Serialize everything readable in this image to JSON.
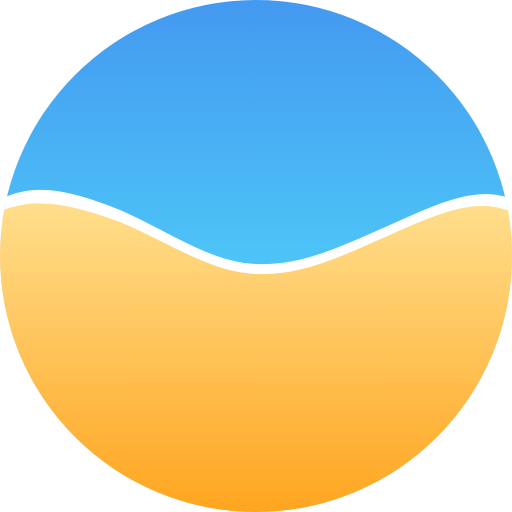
{
  "logo": {
    "icon": "sky-and-sand-circle-icon",
    "colors": {
      "sky_top": "#4499F0",
      "sky_bottom": "#55EEFF",
      "sand_top": "#FFDE8C",
      "sand_bottom": "#FFA51F",
      "divider": "#FFFFFF",
      "background": "#FFFFFF"
    }
  }
}
